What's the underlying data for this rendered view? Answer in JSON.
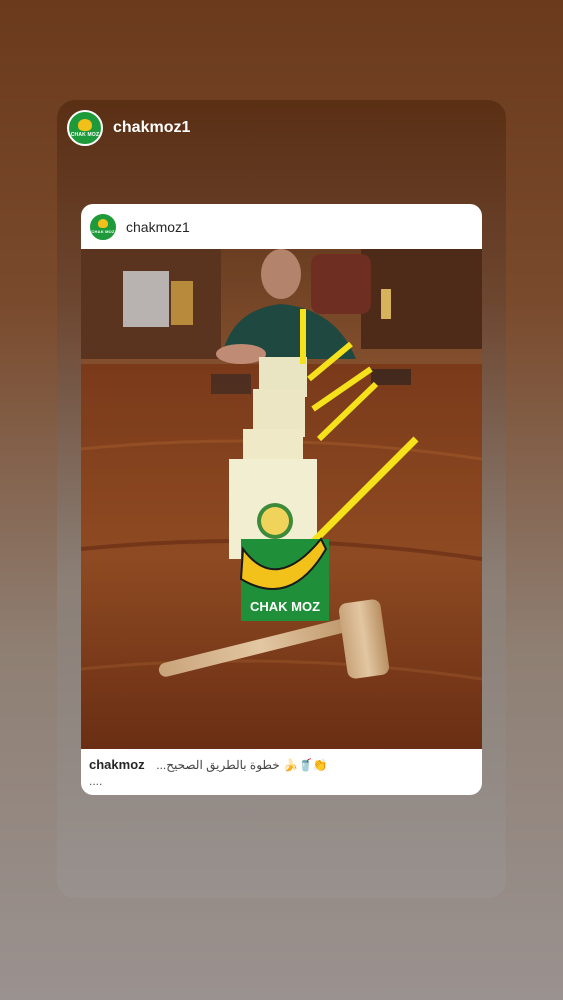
{
  "story": {
    "username": "chakmoz1",
    "logo_text": "CHAK MOZ"
  },
  "post": {
    "username": "chakmoz1",
    "caption_user": "chakmoz",
    "caption_text": "...خطوة بالطريق الصحيح 🍌🥤👏",
    "caption_more": "....",
    "box_label": "CHAK MOZ"
  },
  "icons": {
    "logo": "brand-logo-icon"
  }
}
